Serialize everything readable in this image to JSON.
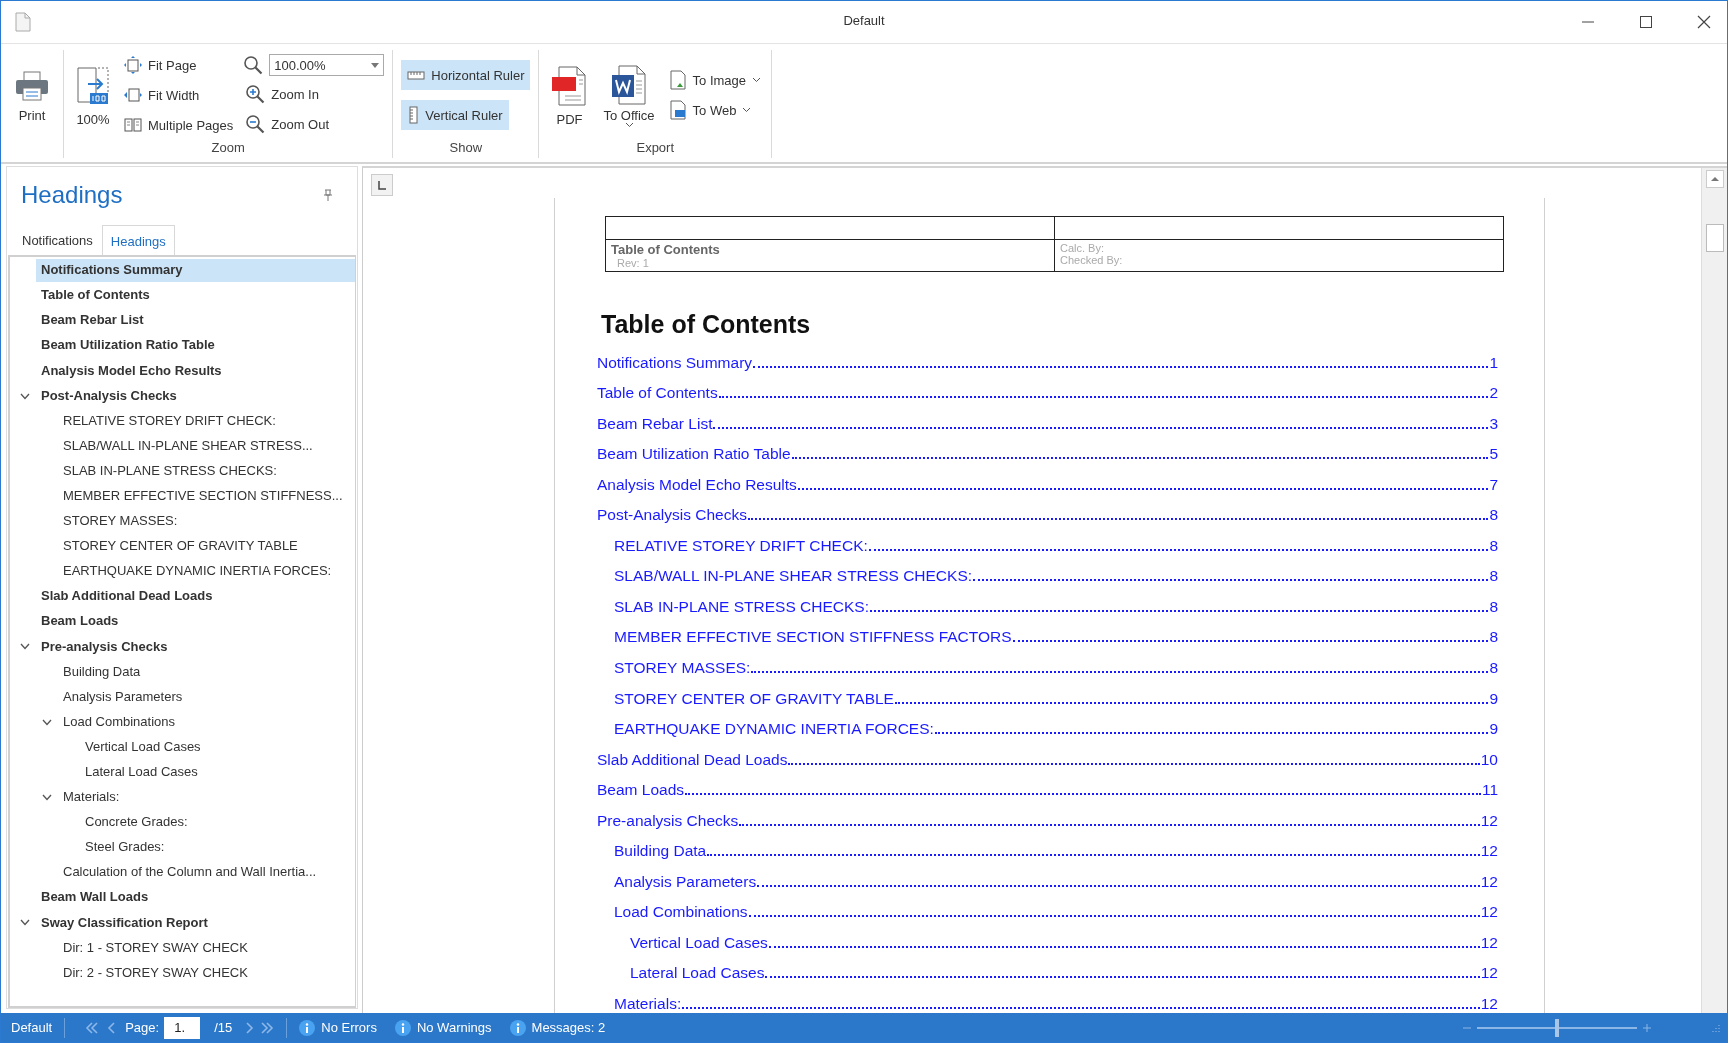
{
  "window": {
    "title": "Default"
  },
  "ribbon": {
    "groups": [
      {
        "columns": [
          [
            {
              "kind": "large",
              "label": "Print"
            }
          ]
        ]
      },
      {
        "label": "Zoom",
        "columns": [
          [
            {
              "kind": "large",
              "label": "100%"
            }
          ],
          [
            {
              "kind": "small",
              "label": "Fit Page"
            },
            {
              "kind": "small",
              "label": "Fit Width"
            },
            {
              "kind": "small",
              "label": "Multiple Pages"
            }
          ],
          [
            {
              "kind": "combo",
              "value": "100.00%"
            },
            {
              "kind": "small",
              "label": "Zoom In"
            },
            {
              "kind": "small",
              "label": "Zoom Out"
            }
          ]
        ]
      },
      {
        "label": "Show",
        "columns": [
          [
            {
              "kind": "toggle",
              "label": "Horizontal Ruler",
              "on": true
            },
            {
              "kind": "toggle",
              "label": "Vertical Ruler",
              "on": true
            }
          ]
        ]
      },
      {
        "label": "Export",
        "columns": [
          [
            {
              "kind": "large",
              "label": "PDF"
            }
          ],
          [
            {
              "kind": "large-menu",
              "label": "To Office"
            }
          ],
          [
            {
              "kind": "small-menu",
              "label": "To Image"
            },
            {
              "kind": "small-menu",
              "label": "To Web"
            }
          ]
        ]
      }
    ]
  },
  "sidebar": {
    "title": "Headings",
    "tabs": [
      {
        "label": "Notifications",
        "selected": false
      },
      {
        "label": "Headings",
        "selected": true
      }
    ],
    "tree": [
      {
        "label": "Notifications Summary",
        "selected": true
      },
      {
        "label": "Table of Contents",
        "selected": false
      },
      {
        "label": "Beam Rebar List",
        "selected": false
      },
      {
        "label": "Beam Utilization Ratio Table",
        "selected": false
      },
      {
        "label": "Analysis Model Echo Results",
        "selected": false
      },
      {
        "label": "Post-Analysis Checks",
        "selected": false,
        "expanded": true,
        "children": [
          {
            "label": "RELATIVE STOREY DRIFT CHECK:",
            "selected": false
          },
          {
            "label": "SLAB/WALL IN-PLANE SHEAR STRESS...",
            "selected": false
          },
          {
            "label": "SLAB IN-PLANE STRESS CHECKS:",
            "selected": false
          },
          {
            "label": "MEMBER EFFECTIVE SECTION STIFFNESS...",
            "selected": false
          },
          {
            "label": "STOREY MASSES:",
            "selected": false
          },
          {
            "label": "STOREY CENTER OF GRAVITY TABLE",
            "selected": false
          },
          {
            "label": "EARTHQUAKE DYNAMIC INERTIA FORCES:",
            "selected": false
          }
        ]
      },
      {
        "label": "Slab Additional Dead Loads",
        "selected": false
      },
      {
        "label": "Beam Loads",
        "selected": false
      },
      {
        "label": "Pre-analysis Checks",
        "selected": false,
        "expanded": true,
        "children": [
          {
            "label": "Building Data",
            "selected": false
          },
          {
            "label": "Analysis Parameters",
            "selected": false
          },
          {
            "label": "Load Combinations",
            "selected": false,
            "expanded": true,
            "children": [
              {
                "label": "Vertical Load Cases",
                "selected": false
              },
              {
                "label": "Lateral Load Cases",
                "selected": false
              }
            ]
          },
          {
            "label": "Materials:",
            "selected": false,
            "expanded": true,
            "children": [
              {
                "label": "Concrete Grades:",
                "selected": false
              },
              {
                "label": "Steel Grades:",
                "selected": false
              }
            ]
          },
          {
            "label": "Calculation of the Column and Wall Inertia...",
            "selected": false
          }
        ]
      },
      {
        "label": "Beam Wall Loads",
        "selected": false
      },
      {
        "label": "Sway Classification Report",
        "selected": false,
        "expanded": true,
        "children": [
          {
            "label": "Dir: 1 - STOREY SWAY CHECK",
            "selected": false
          },
          {
            "label": "Dir: 2 - STOREY SWAY CHECK",
            "selected": false
          }
        ]
      }
    ]
  },
  "document": {
    "header_table": {
      "title": "Table of Contents",
      "revision": "Rev: 1",
      "calc_by": "Calc. By:",
      "checked_by": "Checked By:"
    },
    "toc": {
      "title": "Table of Contents",
      "entries": [
        {
          "text": "Notifications Summary",
          "page": "1"
        },
        {
          "text": "Table of Contents",
          "page": "2"
        },
        {
          "text": "Beam Rebar List",
          "page": "3"
        },
        {
          "text": "Beam Utilization Ratio Table",
          "page": "5"
        },
        {
          "text": "Analysis Model Echo Results",
          "page": "7"
        },
        {
          "text": "Post-Analysis Checks",
          "page": "8",
          "children": [
            {
              "text": "RELATIVE STOREY DRIFT CHECK:",
              "page": "8"
            },
            {
              "text": "SLAB/WALL IN-PLANE SHEAR STRESS CHECKS:",
              "page": "8"
            },
            {
              "text": "SLAB IN-PLANE STRESS CHECKS:",
              "page": "8"
            },
            {
              "text": "MEMBER EFFECTIVE SECTION STIFFNESS FACTORS",
              "page": "8"
            },
            {
              "text": "STOREY MASSES:",
              "page": "8"
            },
            {
              "text": "STOREY CENTER OF GRAVITY TABLE",
              "page": "9"
            },
            {
              "text": "EARTHQUAKE DYNAMIC INERTIA FORCES:",
              "page": "9"
            }
          ]
        },
        {
          "text": "Slab Additional Dead Loads",
          "page": "10"
        },
        {
          "text": "Beam Loads",
          "page": "11"
        },
        {
          "text": "Pre-analysis Checks",
          "page": "12",
          "children": [
            {
              "text": "Building Data",
              "page": "12"
            },
            {
              "text": "Analysis Parameters",
              "page": "12"
            },
            {
              "text": "Load Combinations",
              "page": "12",
              "children": [
                {
                  "text": "Vertical Load Cases",
                  "page": "12"
                },
                {
                  "text": "Lateral Load Cases",
                  "page": "12"
                }
              ]
            },
            {
              "text": "Materials:",
              "page": "12"
            }
          ]
        }
      ]
    }
  },
  "status_bar": {
    "profile": "Default",
    "page_label": "Page:",
    "page_value": "1.",
    "page_total": "/15",
    "messages": [
      {
        "text": "No Errors"
      },
      {
        "text": "No Warnings"
      },
      {
        "text": "Messages: 2"
      }
    ],
    "zoom": {
      "level": 0.5
    }
  }
}
